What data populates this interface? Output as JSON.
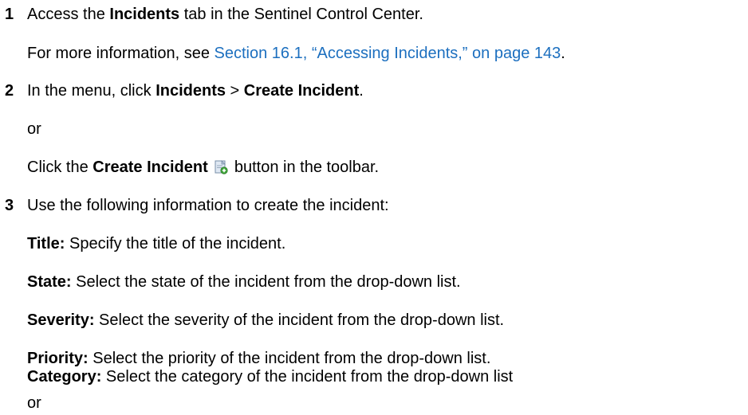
{
  "steps": [
    {
      "number": "1",
      "pre": "Access the ",
      "bold": "Incidents",
      "post": " tab in the Sentinel Control Center.",
      "info_pre": "For more information, see ",
      "info_link": "Section 16.1, “Accessing Incidents,” on page 143",
      "info_post": "."
    },
    {
      "number": "2",
      "pre": "In the menu, click ",
      "bold1": "Incidents",
      "mid": " > ",
      "bold2": "Create Incident",
      "post": ".",
      "or": "or",
      "alt_pre": "Click the ",
      "alt_bold": "Create Incident",
      "alt_post": " button in the toolbar.",
      "icon": "create-incident-icon"
    },
    {
      "number": "3",
      "text": "Use the following information to create the incident:",
      "fields": [
        {
          "label": "Title:",
          "desc": " Specify the title of the incident."
        },
        {
          "label": "State:",
          "desc": " Select the state of the incident from the drop-down list."
        },
        {
          "label": "Severity:",
          "desc": " Select the severity of the incident from the drop-down list."
        },
        {
          "label": "Priority:",
          "desc": " Select the priority of the incident from the drop-down list."
        },
        {
          "label": "Category:",
          "desc": " Select the category of the incident from the drop-down list"
        }
      ],
      "or": "or"
    }
  ],
  "colors": {
    "link": "#1c6fbf",
    "text": "#000000"
  }
}
